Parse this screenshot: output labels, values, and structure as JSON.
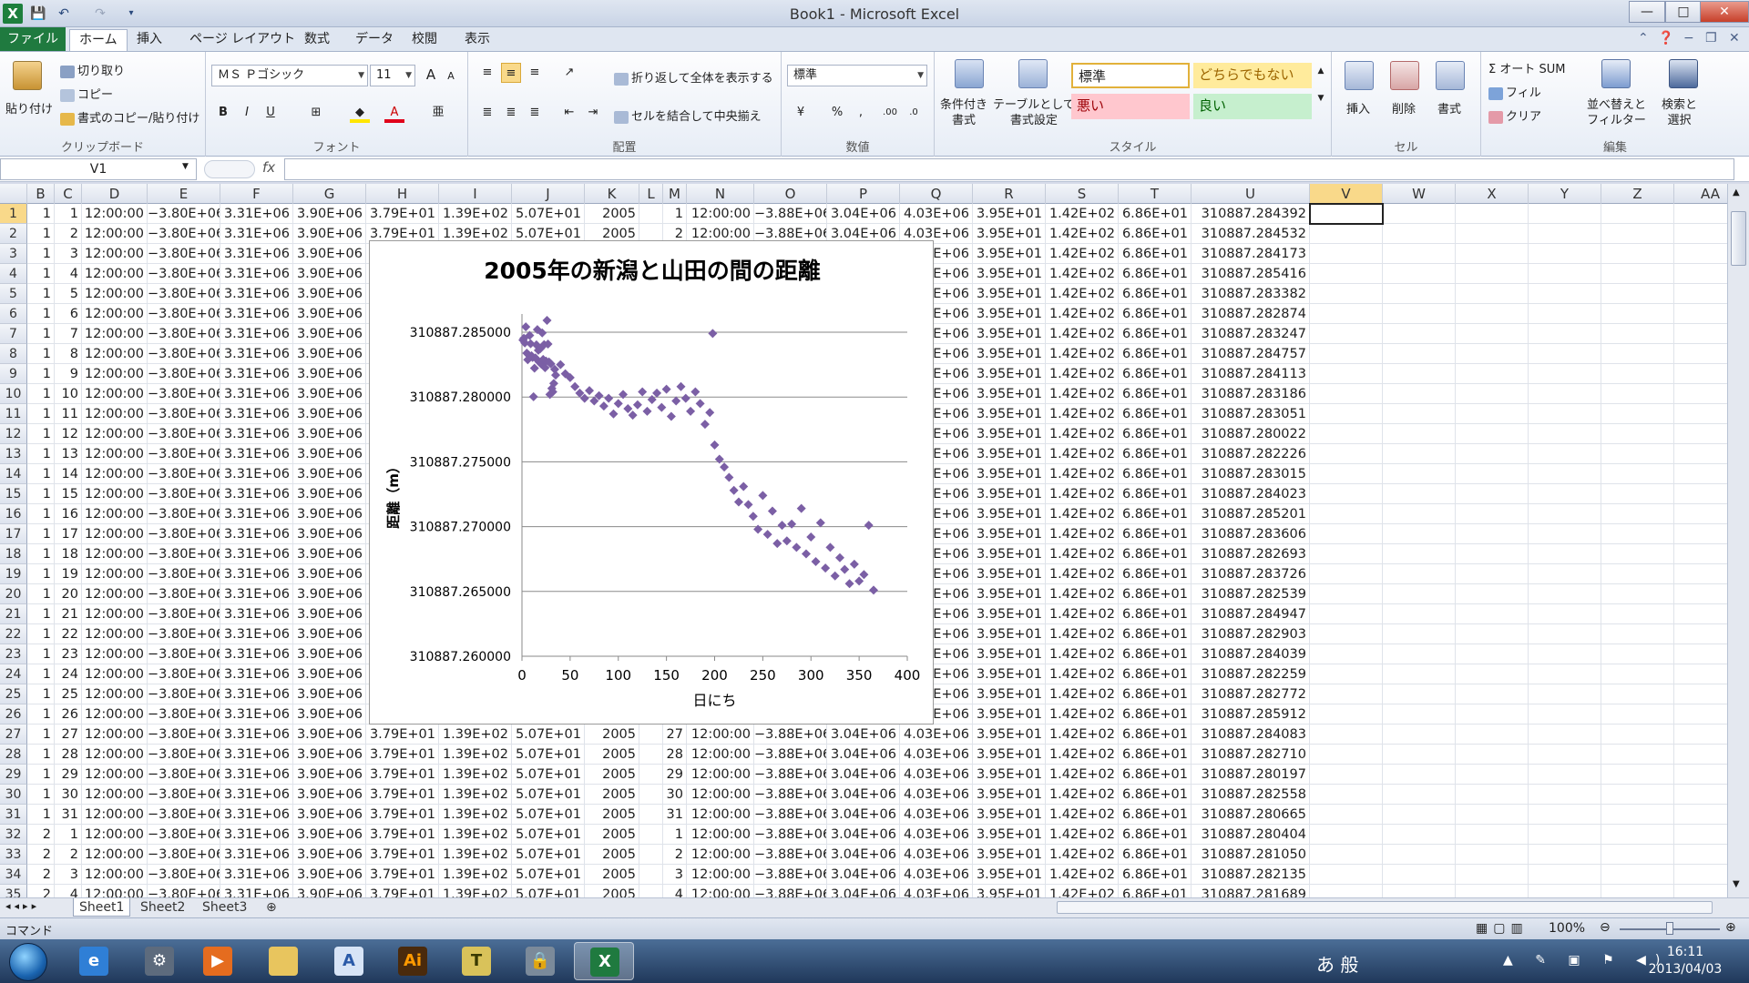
{
  "window": {
    "title": "Book1 - Microsoft Excel",
    "minimize": "—",
    "maximize": "□",
    "close": "✕"
  },
  "qat": {
    "save": "💾",
    "undo": "↶",
    "redo": "↷",
    "customize": "▾"
  },
  "tabs": [
    "ファイル",
    "ホーム",
    "挿入",
    "ページ レイアウト",
    "数式",
    "データ",
    "校閲",
    "表示"
  ],
  "ribbon": {
    "clipboard": {
      "label": "クリップボード",
      "paste": "貼り付け",
      "cut": "切り取り",
      "copy": "コピー",
      "format_painter": "書式のコピー/貼り付け"
    },
    "font": {
      "label": "フォント",
      "name": "ＭＳ Ｐゴシック",
      "size": "11",
      "grow": "A",
      "shrink": "A",
      "bold": "B",
      "italic": "I",
      "underline": "U"
    },
    "alignment": {
      "label": "配置",
      "wrap": "折り返して全体を表示する",
      "merge": "セルを結合して中央揃え"
    },
    "number": {
      "label": "数値",
      "format": "標準",
      "percent": "%",
      "comma": ","
    },
    "styles": {
      "label": "スタイル",
      "conditional": "条件付き\n書式",
      "table": "テーブルとして\n書式設定",
      "normal": "標準",
      "neutral": "どちらでもない",
      "bad": "悪い",
      "good": "良い"
    },
    "cells": {
      "label": "セル",
      "insert": "挿入",
      "delete": "削除",
      "format": "書式"
    },
    "editing": {
      "label": "編集",
      "autosum": "オート SUM",
      "fill": "フィル",
      "clear": "クリア",
      "sort": "並べ替えと\nフィルター",
      "find": "検索と\n選択"
    }
  },
  "formula_bar": {
    "name_box": "V1",
    "fx": "fx",
    "formula": ""
  },
  "columns": [
    "B",
    "C",
    "D",
    "E",
    "F",
    "G",
    "H",
    "I",
    "J",
    "K",
    "L",
    "M",
    "N",
    "O",
    "P",
    "Q",
    "R",
    "S",
    "T",
    "U",
    "V",
    "W",
    "X",
    "Y",
    "Z",
    "AA"
  ],
  "selected_column": "V",
  "rows": [
    {
      "n": "1",
      "B": "1",
      "C": "1",
      "U": "310887.284392",
      "M": "1"
    },
    {
      "n": "2",
      "B": "1",
      "C": "2",
      "U": "310887.284532",
      "M": "2"
    },
    {
      "n": "3",
      "B": "1",
      "C": "3",
      "U": "310887.284173",
      "M": "3"
    },
    {
      "n": "4",
      "B": "1",
      "C": "4",
      "U": "310887.285416",
      "M": "4"
    },
    {
      "n": "5",
      "B": "1",
      "C": "5",
      "U": "310887.283382",
      "M": "5"
    },
    {
      "n": "6",
      "B": "1",
      "C": "6",
      "U": "310887.282874",
      "M": "6"
    },
    {
      "n": "7",
      "B": "1",
      "C": "7",
      "U": "310887.283247",
      "M": "7"
    },
    {
      "n": "8",
      "B": "1",
      "C": "8",
      "U": "310887.284757",
      "M": "8"
    },
    {
      "n": "9",
      "B": "1",
      "C": "9",
      "U": "310887.284113",
      "M": "9"
    },
    {
      "n": "10",
      "B": "1",
      "C": "10",
      "U": "310887.283186",
      "M": "10"
    },
    {
      "n": "11",
      "B": "1",
      "C": "11",
      "U": "310887.283051",
      "M": "11"
    },
    {
      "n": "12",
      "B": "1",
      "C": "12",
      "U": "310887.280022",
      "M": "12"
    },
    {
      "n": "13",
      "B": "1",
      "C": "13",
      "U": "310887.282226",
      "M": "13"
    },
    {
      "n": "14",
      "B": "1",
      "C": "14",
      "U": "310887.283015",
      "M": "14"
    },
    {
      "n": "15",
      "B": "1",
      "C": "15",
      "U": "310887.284023",
      "M": "15"
    },
    {
      "n": "16",
      "B": "1",
      "C": "16",
      "U": "310887.285201",
      "M": "16"
    },
    {
      "n": "17",
      "B": "1",
      "C": "17",
      "U": "310887.283606",
      "M": "17"
    },
    {
      "n": "18",
      "B": "1",
      "C": "18",
      "U": "310887.282693",
      "M": "18"
    },
    {
      "n": "19",
      "B": "1",
      "C": "19",
      "U": "310887.283726",
      "M": "19"
    },
    {
      "n": "20",
      "B": "1",
      "C": "20",
      "U": "310887.282539",
      "M": "20"
    },
    {
      "n": "21",
      "B": "1",
      "C": "21",
      "U": "310887.284947",
      "M": "21"
    },
    {
      "n": "22",
      "B": "1",
      "C": "22",
      "U": "310887.282903",
      "M": "22"
    },
    {
      "n": "23",
      "B": "1",
      "C": "23",
      "U": "310887.284039",
      "M": "23"
    },
    {
      "n": "24",
      "B": "1",
      "C": "24",
      "U": "310887.282259",
      "M": "24"
    },
    {
      "n": "25",
      "B": "1",
      "C": "25",
      "U": "310887.282772",
      "M": "25"
    },
    {
      "n": "26",
      "B": "1",
      "C": "26",
      "U": "310887.285912",
      "M": "26"
    },
    {
      "n": "27",
      "B": "1",
      "C": "27",
      "U": "310887.284083",
      "M": "27"
    },
    {
      "n": "28",
      "B": "1",
      "C": "28",
      "U": "310887.282710",
      "M": "28"
    },
    {
      "n": "29",
      "B": "1",
      "C": "29",
      "U": "310887.280197",
      "M": "29"
    },
    {
      "n": "30",
      "B": "1",
      "C": "30",
      "U": "310887.282558",
      "M": "30"
    },
    {
      "n": "31",
      "B": "1",
      "C": "31",
      "U": "310887.280665",
      "M": "31"
    },
    {
      "n": "32",
      "B": "2",
      "C": "1",
      "U": "310887.280404",
      "M": "1"
    },
    {
      "n": "33",
      "B": "2",
      "C": "2",
      "U": "310887.281050",
      "M": "2"
    },
    {
      "n": "34",
      "B": "2",
      "C": "3",
      "U": "310887.282135",
      "M": "3"
    },
    {
      "n": "35",
      "B": "2",
      "C": "4",
      "U": "310887.281689",
      "M": "4"
    }
  ],
  "row_constants": {
    "D": "12:00:00",
    "E": "−3.80E+06",
    "F": "3.31E+06",
    "G": "3.90E+06",
    "H": "3.79E+01",
    "I": "1.39E+02",
    "J": "5.07E+01",
    "K": "2005",
    "N": "12:00:00",
    "O": "−3.88E+06",
    "P": "3.04E+06",
    "Q": "4.03E+06",
    "R": "3.95E+01",
    "S": "1.42E+02",
    "T": "6.86E+01"
  },
  "chart_data": {
    "type": "scatter",
    "title": "2005年の新潟と山田の間の距離",
    "xlabel": "日にち",
    "ylabel": "距離（m）",
    "xlim": [
      0,
      400
    ],
    "ylim": [
      310887.26,
      310887.285
    ],
    "xticks": [
      "0",
      "50",
      "100",
      "150",
      "200",
      "250",
      "300",
      "350",
      "400"
    ],
    "yticks": [
      "310887.260000",
      "310887.265000",
      "310887.270000",
      "310887.275000",
      "310887.280000",
      "310887.285000"
    ],
    "grid": true,
    "marker_color": "#7B5FA5",
    "series": [
      {
        "x": [
          1,
          2,
          3,
          4,
          5,
          6,
          7,
          8,
          9,
          10,
          11,
          12,
          13,
          14,
          15,
          16,
          17,
          18,
          19,
          20,
          21,
          22,
          23,
          24,
          25,
          26,
          27,
          28,
          29,
          30,
          31,
          32,
          33,
          34,
          35,
          40,
          45,
          50,
          55,
          60,
          65,
          70,
          75,
          80,
          85,
          90,
          95,
          100,
          105,
          110,
          115,
          120,
          125,
          130,
          135,
          140,
          145,
          150,
          155,
          160,
          165,
          170,
          175,
          180,
          185,
          190,
          195,
          198,
          200,
          205,
          210,
          215,
          220,
          225,
          230,
          235,
          240,
          245,
          250,
          255,
          260,
          265,
          270,
          275,
          280,
          285,
          290,
          295,
          300,
          305,
          310,
          315,
          320,
          325,
          330,
          335,
          340,
          345,
          350,
          355,
          360,
          365
        ],
        "y": [
          310887.284392,
          310887.284532,
          310887.284173,
          310887.285416,
          310887.283382,
          310887.282874,
          310887.283247,
          310887.284757,
          310887.284113,
          310887.283186,
          310887.283051,
          310887.280022,
          310887.282226,
          310887.283015,
          310887.284023,
          310887.285201,
          310887.283606,
          310887.282693,
          310887.283726,
          310887.282539,
          310887.284947,
          310887.282903,
          310887.284039,
          310887.282259,
          310887.282772,
          310887.285912,
          310887.284083,
          310887.28271,
          310887.280197,
          310887.282558,
          310887.280665,
          310887.280404,
          310887.28105,
          310887.282135,
          310887.281689,
          310887.2825,
          310887.2818,
          310887.2815,
          310887.2808,
          310887.2803,
          310887.2799,
          310887.2805,
          310887.2797,
          310887.2801,
          310887.2793,
          310887.2799,
          310887.2787,
          310887.2795,
          310887.2802,
          310887.2791,
          310887.2786,
          310887.2794,
          310887.2804,
          310887.2789,
          310887.2798,
          310887.2803,
          310887.2792,
          310887.2806,
          310887.2785,
          310887.2797,
          310887.2808,
          310887.2799,
          310887.2789,
          310887.2804,
          310887.2795,
          310887.2779,
          310887.2788,
          310887.2849,
          310887.2763,
          310887.2752,
          310887.2746,
          310887.2738,
          310887.2728,
          310887.2719,
          310887.2731,
          310887.2717,
          310887.2708,
          310887.2698,
          310887.2724,
          310887.2694,
          310887.2712,
          310887.2687,
          310887.2701,
          310887.2689,
          310887.2702,
          310887.2684,
          310887.2714,
          310887.2679,
          310887.2692,
          310887.2673,
          310887.2703,
          310887.2668,
          310887.2684,
          310887.2662,
          310887.2676,
          310887.2667,
          310887.2656,
          310887.2671,
          310887.2658,
          310887.2663,
          310887.2701,
          310887.2651
        ]
      }
    ]
  },
  "sheets": [
    "Sheet1",
    "Sheet2",
    "Sheet3"
  ],
  "status": {
    "mode": "コマンド",
    "zoom": "100%"
  },
  "taskbar": {
    "apps": [
      "ie-app",
      "settings-app",
      "media-app",
      "explorer-app",
      "word-app",
      "illustrator-app",
      "text-app",
      "secure-app",
      "excel-app"
    ],
    "illustrator": "Ai",
    "ime": "あ 般",
    "time": "16:11",
    "date": "2013/04/03"
  }
}
